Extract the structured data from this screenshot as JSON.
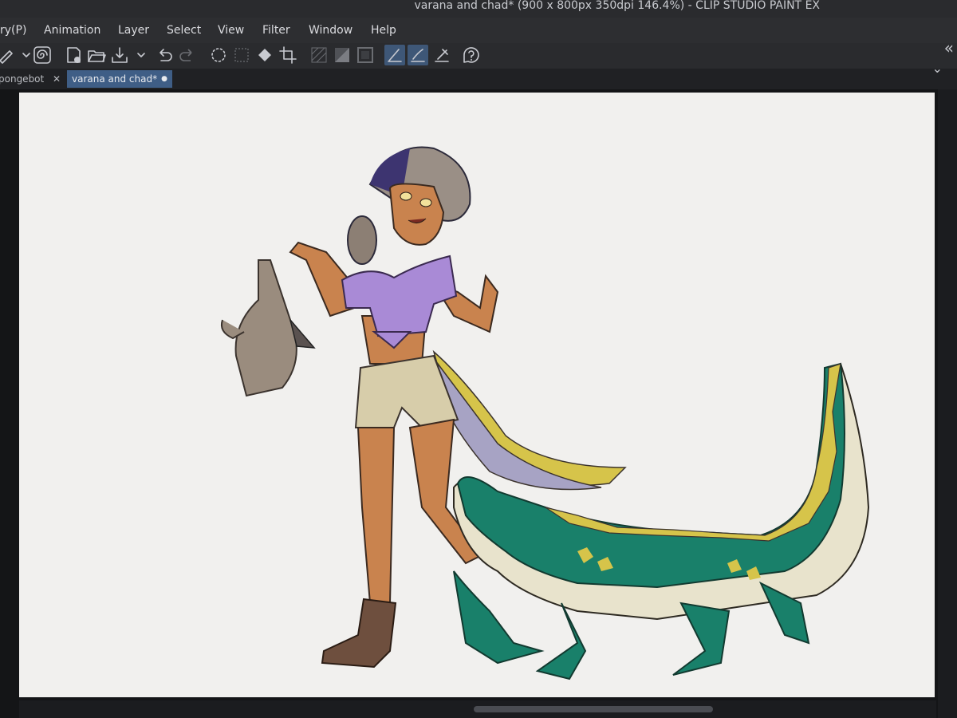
{
  "app": {
    "window_title": "varana and chad* (900 x 800px 350dpi 146.4%)  - CLIP STUDIO PAINT EX"
  },
  "menu": {
    "items": [
      "ry(P)",
      "Animation",
      "Layer",
      "Select",
      "View",
      "Filter",
      "Window",
      "Help"
    ]
  },
  "tabs": [
    {
      "label": "pongebot",
      "close_glyph": "✕"
    },
    {
      "label": "varana and chad*",
      "close_glyph": "●"
    }
  ],
  "toolbar": {
    "icons": [
      "brush-icon",
      "chevron-down-icon",
      "spiral-icon",
      "new-file-icon",
      "open-folder-icon",
      "save-icon",
      "chevron-down-icon",
      "undo-icon",
      "redo-icon",
      "selection-loading-icon",
      "fill-selection-icon",
      "diamond-icon",
      "crop-icon",
      "hatch-icon",
      "gradient-icon",
      "frame-icon",
      "pen-icon",
      "brush-stroke-icon",
      "ruler-pen-icon",
      "help-icon"
    ]
  },
  "scroll": {
    "expand_glyph": "«",
    "down_glyph": "⌄"
  },
  "colors": {
    "canvas_bg": "#f1f0ee",
    "ui_dark": "#2d2e31",
    "active_tab": "#3f5e86",
    "shirt": "#a98ad6",
    "skin": "#c9834e",
    "shorts": "#d7cdaa",
    "croc_green": "#19806a",
    "croc_belly": "#e8e3cc",
    "croc_spikes": "#d6c44a",
    "bag": "#9a8c7e",
    "boot": "#6e4f3e"
  }
}
